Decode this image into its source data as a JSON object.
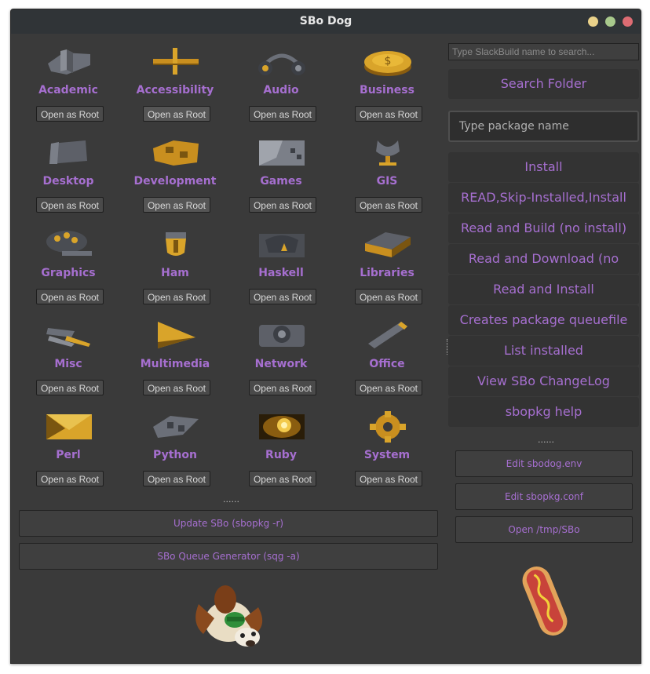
{
  "window": {
    "title": "SBo Dog"
  },
  "categories": [
    {
      "label": "Academic",
      "icon": "academic-icon",
      "root": "Open as Root"
    },
    {
      "label": "Accessibility",
      "icon": "accessibility-icon",
      "root": "Open as Root"
    },
    {
      "label": "Audio",
      "icon": "audio-icon",
      "root": "Open as Root"
    },
    {
      "label": "Business",
      "icon": "business-icon",
      "root": "Open as Root"
    },
    {
      "label": "Desktop",
      "icon": "desktop-icon",
      "root": "Open as Root"
    },
    {
      "label": "Development",
      "icon": "development-icon",
      "root": "Open as Root"
    },
    {
      "label": "Games",
      "icon": "games-icon",
      "root": "Open as Root"
    },
    {
      "label": "GIS",
      "icon": "gis-icon",
      "root": "Open as Root"
    },
    {
      "label": "Graphics",
      "icon": "graphics-icon",
      "root": "Open as Root"
    },
    {
      "label": "Ham",
      "icon": "ham-icon",
      "root": "Open as Root"
    },
    {
      "label": "Haskell",
      "icon": "haskell-icon",
      "root": "Open as Root"
    },
    {
      "label": "Libraries",
      "icon": "libraries-icon",
      "root": "Open as Root"
    },
    {
      "label": "Misc",
      "icon": "misc-icon",
      "root": "Open as Root"
    },
    {
      "label": "Multimedia",
      "icon": "multimedia-icon",
      "root": "Open as Root"
    },
    {
      "label": "Network",
      "icon": "network-icon",
      "root": "Open as Root"
    },
    {
      "label": "Office",
      "icon": "office-icon",
      "root": "Open as Root"
    },
    {
      "label": "Perl",
      "icon": "perl-icon",
      "root": "Open as Root"
    },
    {
      "label": "Python",
      "icon": "python-icon",
      "root": "Open as Root"
    },
    {
      "label": "Ruby",
      "icon": "ruby-icon",
      "root": "Open as Root"
    },
    {
      "label": "System",
      "icon": "system-icon",
      "root": "Open as Root"
    }
  ],
  "left_dots": "......",
  "update_button": "Update SBo (sbopkg -r)",
  "queue_button": "SBo Queue Generator (sqg -a)",
  "mascot_icon": "dog-mascot-icon",
  "sidebar": {
    "search_placeholder": "Type SlackBuild name to search...",
    "search_folder": "Search Folder",
    "package_placeholder": "Type package name",
    "actions": [
      "Install",
      "READ,Skip-Installed,Install",
      "Read and Build (no install)",
      "Read and Download (no build))",
      "Read and Install",
      "Creates package queuefile",
      "List installed",
      "View SBo ChangeLog",
      "sbopkg help"
    ],
    "dots": "......",
    "edit_buttons": [
      "Edit sbodog.env",
      "Edit sbopkg.conf",
      "Open /tmp/SBo"
    ],
    "hotdog_icon": "hotdog-icon"
  },
  "colors": {
    "accent": "#a66fd0",
    "background": "#3a3a3a",
    "titlebar": "#303437",
    "gold": "#d9a42a"
  }
}
